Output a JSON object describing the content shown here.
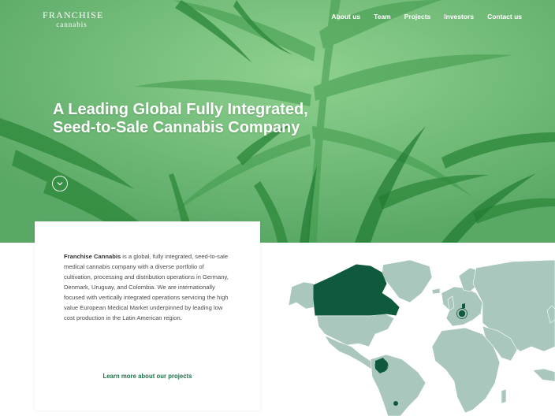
{
  "header": {
    "logo_line1": "FRANCHISE",
    "logo_line2": "cannabis",
    "nav": [
      "About us",
      "Team",
      "Projects",
      "Investors",
      "Contact us"
    ]
  },
  "hero": {
    "title_line1": "A Leading Global Fully Integrated,",
    "title_line2": "Seed-to-Sale Cannabis Company",
    "scroll_icon": "chevron-down-icon"
  },
  "intro": {
    "company_name": "Franchise Cannabis",
    "body": " is a global, fully integrated, seed-to-sale medical cannabis company with a diverse portfolio of cultivation, processing and distribution operations in Germany, Denmark, Uruguay, and Colombia. We are internationally focused with vertically integrated operations servicing the high value European Medical Market underpinned by leading low cost production in the Latin American region.",
    "link_label": "Learn more about our projects"
  },
  "map": {
    "highlighted_countries": [
      "Canada",
      "Germany",
      "Denmark",
      "Colombia",
      "Uruguay"
    ]
  },
  "colors": {
    "hero_green": "#67b36f",
    "leaf_dark": "#2e8a3c",
    "map_land": "#a9c7bc",
    "map_highlight": "#0f5a3d",
    "link_green": "#1f6e4a"
  }
}
